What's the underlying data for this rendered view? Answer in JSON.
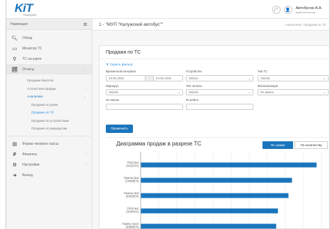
{
  "header": {
    "logo_text": "KiT",
    "logo_sub": "Transport",
    "user_name": "Автобусов А.А.",
    "user_role": "Администратор"
  },
  "sidebar": {
    "title": "Навигация",
    "items": [
      {
        "label": "Обзор",
        "icon": "search-icon"
      },
      {
        "label": "Монитор ТС",
        "icon": "monitor-icon"
      },
      {
        "label": "ТС на карте",
        "icon": "map-pin-icon"
      },
      {
        "label": "Отчеты",
        "icon": "chart-icon"
      }
    ],
    "reports_sub": [
      {
        "label": "Продажи билетов"
      },
      {
        "label": "Статистика продаж"
      },
      {
        "label": "Аналитика"
      }
    ],
    "analytics_sub": [
      {
        "label": "Продажи по дням"
      },
      {
        "label": "Продажи по ТС"
      },
      {
        "label": "Продажи по устройствам"
      },
      {
        "label": "Продажи по маршрутам"
      }
    ],
    "bottom_items": [
      {
        "label": "Форма чекового кассы",
        "icon": "register-icon"
      },
      {
        "label": "Финансы",
        "icon": "ruble-icon"
      },
      {
        "label": "Настройки",
        "icon": "gears-icon"
      },
      {
        "label": "Выход",
        "icon": "logout-icon"
      }
    ]
  },
  "page": {
    "title": "1 - \"МУП \"Калужский автобус\"\"",
    "breadcrumb": "Аналитика / Продажи по ТС"
  },
  "panel": {
    "title": "Продажи по ТС",
    "hide_filter": "Скрыть фильтр",
    "apply_label": "Применить"
  },
  "filters": {
    "time_label": "Временной интервал",
    "date_from": "23.05.2020",
    "date_sep": "-",
    "date_to": "04.06.2020",
    "device_label": "Устройство",
    "device_value": "Любое",
    "vtype_label": "Тип ТС",
    "vtype_value": "Любой",
    "route_label": "Маршрут",
    "route_value": "Любой",
    "paytype_label": "Тип оплаты",
    "paytype_value": "Любой",
    "fiscal_label": "Фискализация",
    "fiscal_value": "Не важно",
    "shift_label": "№ смены",
    "shift_value": "",
    "trip_label": "№ рейса",
    "trip_value": ""
  },
  "chart_header": {
    "title": "Диаграмма продаж в разрезе ТС",
    "btn_sum": "По сумме",
    "btn_count": "По количеству"
  },
  "chart_data": {
    "type": "bar",
    "orientation": "horizontal",
    "accent": "#1b75bc",
    "categories": [
      [
        "ПАЗ №4",
        "(Х222УА)"
      ],
      [
        "Газель №3",
        "(О488ЕН)"
      ],
      [
        "Газель №3",
        "(Х455ЕН)"
      ],
      [
        "ПАЗ №2",
        "(Х044УА)"
      ],
      [
        "Газель №13",
        "(Х088ЕН)"
      ]
    ],
    "values": [
      100,
      86,
      84,
      78,
      77
    ]
  }
}
